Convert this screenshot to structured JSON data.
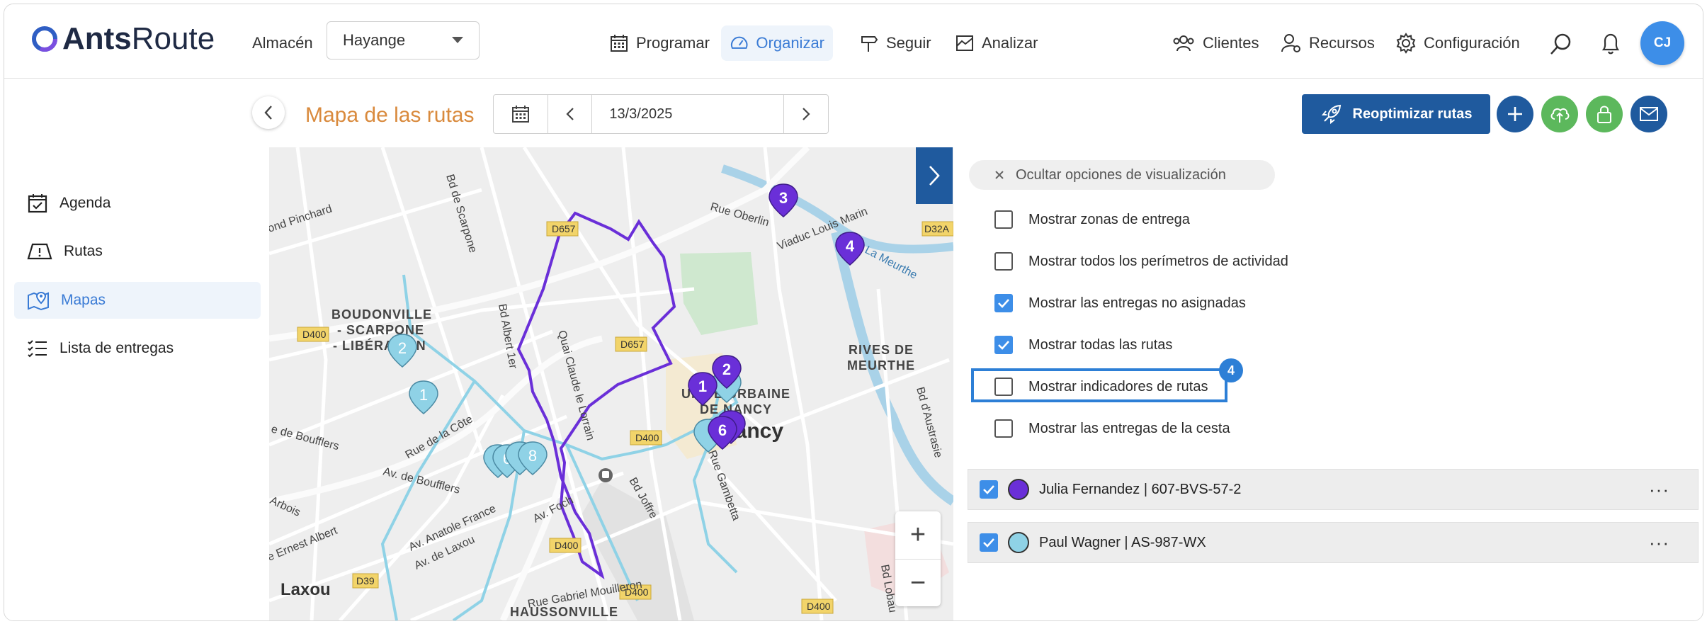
{
  "header": {
    "logo_bold": "Ants",
    "logo_light": "Route",
    "store_label": "Almacén",
    "store_value": "Hayange",
    "nav": [
      {
        "label": "Programar",
        "icon": "calendar-icon"
      },
      {
        "label": "Organizar",
        "icon": "gauge-icon",
        "active": true
      },
      {
        "label": "Seguir",
        "icon": "signpost-icon"
      },
      {
        "label": "Analizar",
        "icon": "chart-icon"
      },
      {
        "label": "Clientes",
        "icon": "clients-icon"
      },
      {
        "label": "Recursos",
        "icon": "resources-icon"
      },
      {
        "label": "Configuración",
        "icon": "gear-icon"
      }
    ],
    "avatar_initials": "CJ"
  },
  "sidebar": {
    "items": [
      {
        "label": "Agenda",
        "icon": "calendar-check-icon"
      },
      {
        "label": "Rutas",
        "icon": "route-warning-icon"
      },
      {
        "label": "Mapas",
        "icon": "map-pin-icon",
        "active": true
      },
      {
        "label": "Lista de entregas",
        "icon": "checklist-icon"
      }
    ]
  },
  "toolbar": {
    "page_title": "Mapa de las rutas",
    "date": "13/3/2025",
    "reoptimize_label": "Reoptimizar rutas"
  },
  "map": {
    "labels": {
      "boudonville": "BOUDONVILLE",
      "scarpone": "- SCARPONE",
      "liberation": "- LIBÉRATION",
      "rives1": "RIVES DE",
      "rives2": "MEURTHE",
      "urbaine": "UNITÉ URBAINE",
      "denancy": "DE NANCY",
      "nancy": "Nancy",
      "laxou": "Laxou",
      "haussonville": "HAUSSONVILLE",
      "pinchard": "ond Pinchard",
      "scarpone_rd": "Bd de Scarpone",
      "albert": "Bd Albert 1er",
      "claude": "Quai Claude le Lorrain",
      "oberlin": "Rue Oberlin",
      "viaduc": "Viaduc Louis Marin",
      "meurthe": "La Meurthe",
      "boufflers": "e de Boufflers",
      "cote": "Rue de la Côte",
      "avboufflers": "Av. de Boufflers",
      "foch": "Av. Foch",
      "anatole": "Av. Anatole France",
      "avlaxou": "Av. de Laxou",
      "ernest": "e Ernest Albert",
      "arbois": "Arbois",
      "gabriel": "Rue Gabriel Mouilleron",
      "joffre": "Bd Joffre",
      "lobau": "Bd Lobau",
      "bdaustrasie": "Bd d'Austrasie",
      "gambetta": "Rue Gambetta",
      "d657a": "D657",
      "d657b": "D657",
      "d400a": "D400",
      "d400b": "D400",
      "d400c": "D400",
      "d400d": "D400",
      "d400e": "D400",
      "d32a": "D32A",
      "d39": "D39",
      "db": "D"
    },
    "pins": [
      {
        "n": "3",
        "color": "#6a2fd8"
      },
      {
        "n": "4",
        "color": "#6a2fd8"
      },
      {
        "n": "2",
        "color": "#6a2fd8"
      },
      {
        "n": "1",
        "color": "#6a2fd8"
      },
      {
        "n": "6",
        "color": "#6a2fd8"
      },
      {
        "n": "2",
        "color": "#8fd2e6"
      },
      {
        "n": "1",
        "color": "#8fd2e6"
      },
      {
        "n": "6",
        "color": "#8fd2e6"
      },
      {
        "n": "8",
        "color": "#8fd2e6"
      }
    ]
  },
  "panel": {
    "hide_label": "Ocultar opciones de visualización",
    "options": [
      {
        "label": "Mostrar zonas de entrega",
        "checked": false
      },
      {
        "label": "Mostrar todos los perímetros de actividad",
        "checked": false
      },
      {
        "label": "Mostrar las entregas no asignadas",
        "checked": true
      },
      {
        "label": "Mostrar todas las rutas",
        "checked": true
      },
      {
        "label": "Mostrar indicadores de rutas",
        "checked": false
      },
      {
        "label": "Mostrar las entregas de la cesta",
        "checked": false
      }
    ],
    "step_badge": "4",
    "routes": [
      {
        "label": "Julia Fernandez | 607-BVS-57-2",
        "color": "#6a2fd8",
        "checked": true
      },
      {
        "label": "Paul Wagner | AS-987-WX",
        "color": "#8fd2e6",
        "checked": true
      }
    ],
    "more_label": "···"
  },
  "colors": {
    "accent": "#3d8ee8",
    "primary_dark": "#1f5a9e",
    "title_orange": "#d98a3d",
    "route_purple": "#6a2fd8",
    "route_light_blue": "#8fd2e6",
    "green_btn": "#5cb85c"
  }
}
